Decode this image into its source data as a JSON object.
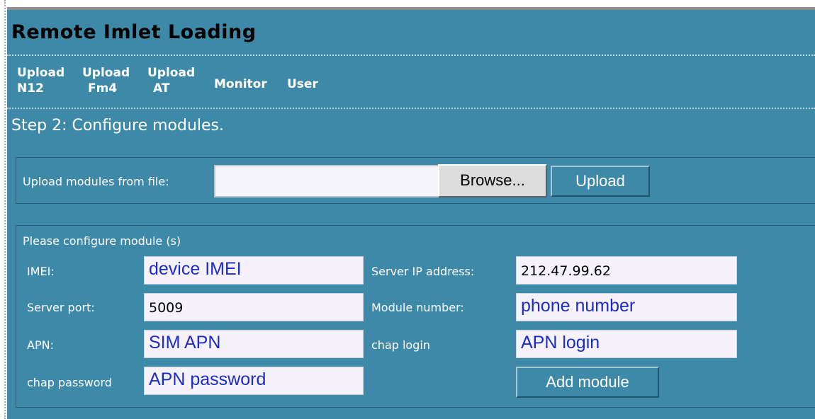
{
  "page": {
    "title": "Remote Imlet Loading",
    "step": "Step 2: Configure modules."
  },
  "nav": {
    "upload_n12": [
      "Upload",
      "N12"
    ],
    "upload_fm4": [
      "Upload",
      "Fm4"
    ],
    "upload_at": [
      "Upload",
      "AT"
    ],
    "monitor": "Monitor",
    "user": "User"
  },
  "upload_file": {
    "label": "Upload modules from file:",
    "value": "",
    "browse_label": "Browse...",
    "upload_label": "Upload"
  },
  "config": {
    "heading": "Please configure module (s)",
    "imei": {
      "label": "IMEI:",
      "value": "device IMEI"
    },
    "server_ip": {
      "label": "Server IP address:",
      "value": "212.47.99.62"
    },
    "server_port": {
      "label": "Server port:",
      "value": "5009"
    },
    "module_number": {
      "label": "Module number:",
      "value": "phone number"
    },
    "apn": {
      "label": "APN:",
      "value": "SIM APN"
    },
    "chap_login": {
      "label": "chap login",
      "value": "APN login"
    },
    "chap_password": {
      "label": "chap password",
      "value": "APN password"
    },
    "add_module_label": "Add module"
  },
  "colors": {
    "panel_bg": "#3e88a8",
    "field_bg": "#f6f2fb",
    "placeholder_blue": "#1c2cc8"
  }
}
